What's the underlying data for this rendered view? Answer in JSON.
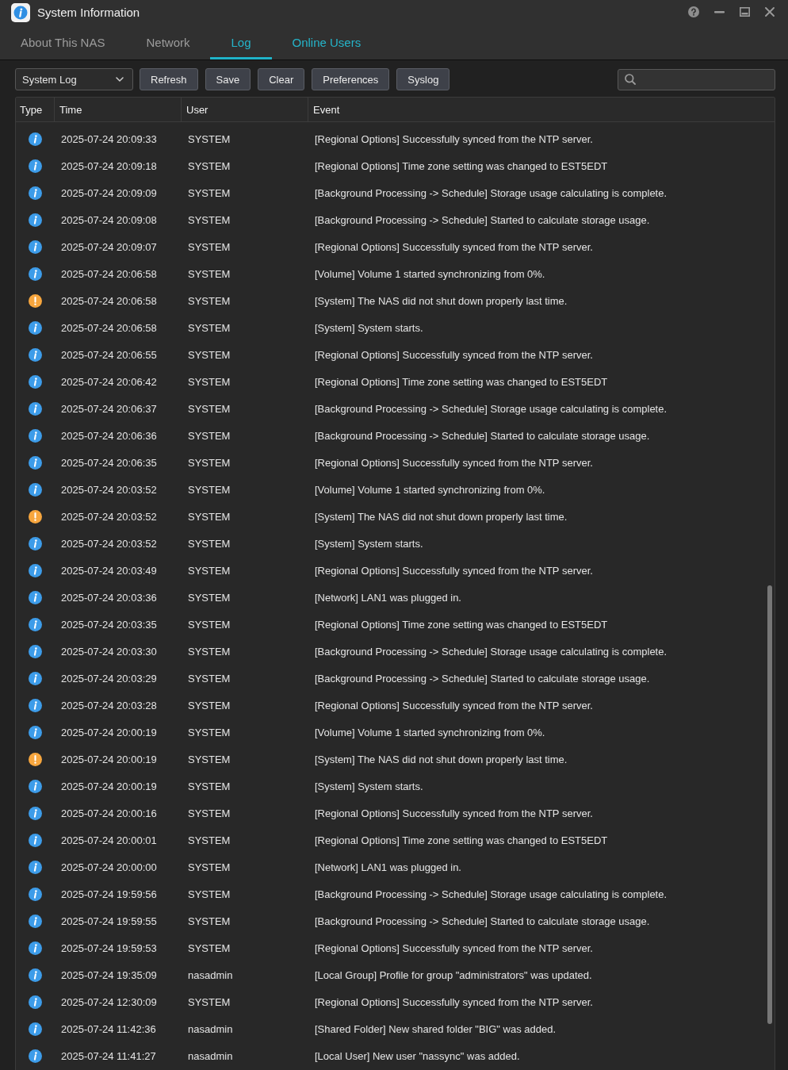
{
  "window": {
    "title": "System Information"
  },
  "tabs": [
    {
      "label": "About This NAS",
      "selected": false,
      "highlighted": false
    },
    {
      "label": "Network",
      "selected": false,
      "highlighted": false
    },
    {
      "label": "Log",
      "selected": true,
      "highlighted": false
    },
    {
      "label": "Online Users",
      "selected": false,
      "highlighted": true
    }
  ],
  "toolbar": {
    "log_select": {
      "value": "System Log"
    },
    "buttons": [
      "Refresh",
      "Save",
      "Clear",
      "Preferences",
      "Syslog"
    ]
  },
  "table": {
    "columns": [
      "Type",
      "Time",
      "User",
      "Event"
    ],
    "rows": [
      {
        "kind": "info",
        "time": "2025-07-24 20:09:33",
        "user": "SYSTEM",
        "event": "[Regional Options] Successfully synced from the NTP server."
      },
      {
        "kind": "info",
        "time": "2025-07-24 20:09:18",
        "user": "SYSTEM",
        "event": "[Regional Options] Time zone setting was changed to EST5EDT"
      },
      {
        "kind": "info",
        "time": "2025-07-24 20:09:09",
        "user": "SYSTEM",
        "event": "[Background Processing -> Schedule] Storage usage calculating is complete."
      },
      {
        "kind": "info",
        "time": "2025-07-24 20:09:08",
        "user": "SYSTEM",
        "event": "[Background Processing -> Schedule] Started to calculate storage usage."
      },
      {
        "kind": "info",
        "time": "2025-07-24 20:09:07",
        "user": "SYSTEM",
        "event": "[Regional Options] Successfully synced from the NTP server."
      },
      {
        "kind": "info",
        "time": "2025-07-24 20:06:58",
        "user": "SYSTEM",
        "event": "[Volume] Volume 1 started synchronizing from 0%."
      },
      {
        "kind": "warning",
        "time": "2025-07-24 20:06:58",
        "user": "SYSTEM",
        "event": "[System] The NAS did not shut down properly last time."
      },
      {
        "kind": "info",
        "time": "2025-07-24 20:06:58",
        "user": "SYSTEM",
        "event": "[System] System starts."
      },
      {
        "kind": "info",
        "time": "2025-07-24 20:06:55",
        "user": "SYSTEM",
        "event": "[Regional Options] Successfully synced from the NTP server."
      },
      {
        "kind": "info",
        "time": "2025-07-24 20:06:42",
        "user": "SYSTEM",
        "event": "[Regional Options] Time zone setting was changed to EST5EDT"
      },
      {
        "kind": "info",
        "time": "2025-07-24 20:06:37",
        "user": "SYSTEM",
        "event": "[Background Processing -> Schedule] Storage usage calculating is complete."
      },
      {
        "kind": "info",
        "time": "2025-07-24 20:06:36",
        "user": "SYSTEM",
        "event": "[Background Processing -> Schedule] Started to calculate storage usage."
      },
      {
        "kind": "info",
        "time": "2025-07-24 20:06:35",
        "user": "SYSTEM",
        "event": "[Regional Options] Successfully synced from the NTP server."
      },
      {
        "kind": "info",
        "time": "2025-07-24 20:03:52",
        "user": "SYSTEM",
        "event": "[Volume] Volume 1 started synchronizing from 0%."
      },
      {
        "kind": "warning",
        "time": "2025-07-24 20:03:52",
        "user": "SYSTEM",
        "event": "[System] The NAS did not shut down properly last time."
      },
      {
        "kind": "info",
        "time": "2025-07-24 20:03:52",
        "user": "SYSTEM",
        "event": "[System] System starts."
      },
      {
        "kind": "info",
        "time": "2025-07-24 20:03:49",
        "user": "SYSTEM",
        "event": "[Regional Options] Successfully synced from the NTP server."
      },
      {
        "kind": "info",
        "time": "2025-07-24 20:03:36",
        "user": "SYSTEM",
        "event": "[Network] LAN1 was plugged in."
      },
      {
        "kind": "info",
        "time": "2025-07-24 20:03:35",
        "user": "SYSTEM",
        "event": "[Regional Options] Time zone setting was changed to EST5EDT"
      },
      {
        "kind": "info",
        "time": "2025-07-24 20:03:30",
        "user": "SYSTEM",
        "event": "[Background Processing -> Schedule] Storage usage calculating is complete."
      },
      {
        "kind": "info",
        "time": "2025-07-24 20:03:29",
        "user": "SYSTEM",
        "event": "[Background Processing -> Schedule] Started to calculate storage usage."
      },
      {
        "kind": "info",
        "time": "2025-07-24 20:03:28",
        "user": "SYSTEM",
        "event": "[Regional Options] Successfully synced from the NTP server."
      },
      {
        "kind": "info",
        "time": "2025-07-24 20:00:19",
        "user": "SYSTEM",
        "event": "[Volume] Volume 1 started synchronizing from 0%."
      },
      {
        "kind": "warning",
        "time": "2025-07-24 20:00:19",
        "user": "SYSTEM",
        "event": "[System] The NAS did not shut down properly last time."
      },
      {
        "kind": "info",
        "time": "2025-07-24 20:00:19",
        "user": "SYSTEM",
        "event": "[System] System starts."
      },
      {
        "kind": "info",
        "time": "2025-07-24 20:00:16",
        "user": "SYSTEM",
        "event": "[Regional Options] Successfully synced from the NTP server."
      },
      {
        "kind": "info",
        "time": "2025-07-24 20:00:01",
        "user": "SYSTEM",
        "event": "[Regional Options] Time zone setting was changed to EST5EDT"
      },
      {
        "kind": "info",
        "time": "2025-07-24 20:00:00",
        "user": "SYSTEM",
        "event": "[Network] LAN1 was plugged in."
      },
      {
        "kind": "info",
        "time": "2025-07-24 19:59:56",
        "user": "SYSTEM",
        "event": "[Background Processing -> Schedule] Storage usage calculating is complete."
      },
      {
        "kind": "info",
        "time": "2025-07-24 19:59:55",
        "user": "SYSTEM",
        "event": "[Background Processing -> Schedule] Started to calculate storage usage."
      },
      {
        "kind": "info",
        "time": "2025-07-24 19:59:53",
        "user": "SYSTEM",
        "event": "[Regional Options] Successfully synced from the NTP server."
      },
      {
        "kind": "info",
        "time": "2025-07-24 19:35:09",
        "user": "nasadmin",
        "event": "[Local Group] Profile for group \"administrators\" was updated."
      },
      {
        "kind": "info",
        "time": "2025-07-24 12:30:09",
        "user": "SYSTEM",
        "event": "[Regional Options] Successfully synced from the NTP server."
      },
      {
        "kind": "info",
        "time": "2025-07-24 11:42:36",
        "user": "nasadmin",
        "event": "[Shared Folder] New shared folder \"BIG\" was added."
      },
      {
        "kind": "info",
        "time": "2025-07-24 11:41:27",
        "user": "nasadmin",
        "event": "[Local User] New user \"nassync\" was added."
      }
    ]
  }
}
